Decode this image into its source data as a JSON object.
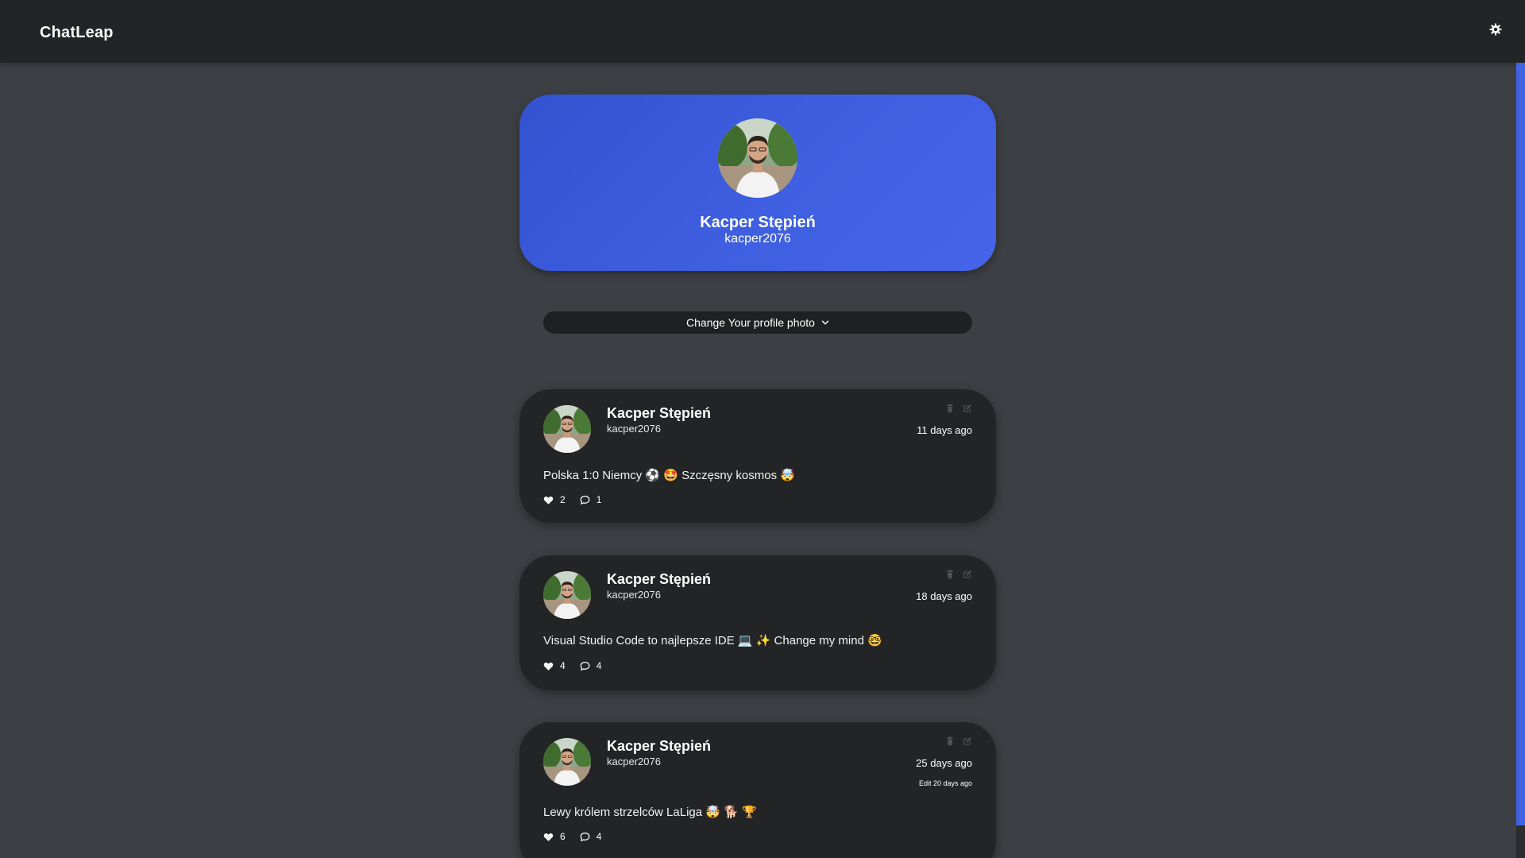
{
  "app": {
    "title": "ChatLeap"
  },
  "profile": {
    "name": "Kacper Stępień",
    "handle": "kacper2076",
    "change_photo_label": "Change Your profile photo"
  },
  "posts": [
    {
      "author": "Kacper Stępień",
      "handle": "kacper2076",
      "time": "11 days ago",
      "edited": "",
      "content": "Polska 1:0 Niemcy ⚽ 🤩 Szczęsny kosmos 🤯",
      "likes": "2",
      "comments": "1"
    },
    {
      "author": "Kacper Stępień",
      "handle": "kacper2076",
      "time": "18 days ago",
      "edited": "",
      "content": "Visual Studio Code to najlepsze IDE 💻 ✨ Change my mind 🤓",
      "likes": "4",
      "comments": "4"
    },
    {
      "author": "Kacper Stępień",
      "handle": "kacper2076",
      "time": "25 days ago",
      "edited": "Edit 20 days ago",
      "content": "Lewy królem strzelców LaLiga 🤯 🐕 🏆",
      "likes": "6",
      "comments": "4"
    }
  ],
  "colors": {
    "page_bg": "#3c3f43",
    "topbar_bg": "#232426",
    "card_bg": "#232426",
    "accent": "#4063e3"
  },
  "icons": {
    "settings": "gear-icon",
    "delete": "trash-icon",
    "edit": "edit-icon",
    "like": "heart-icon",
    "comment": "comment-icon",
    "dropdown": "chevron-down-icon"
  }
}
